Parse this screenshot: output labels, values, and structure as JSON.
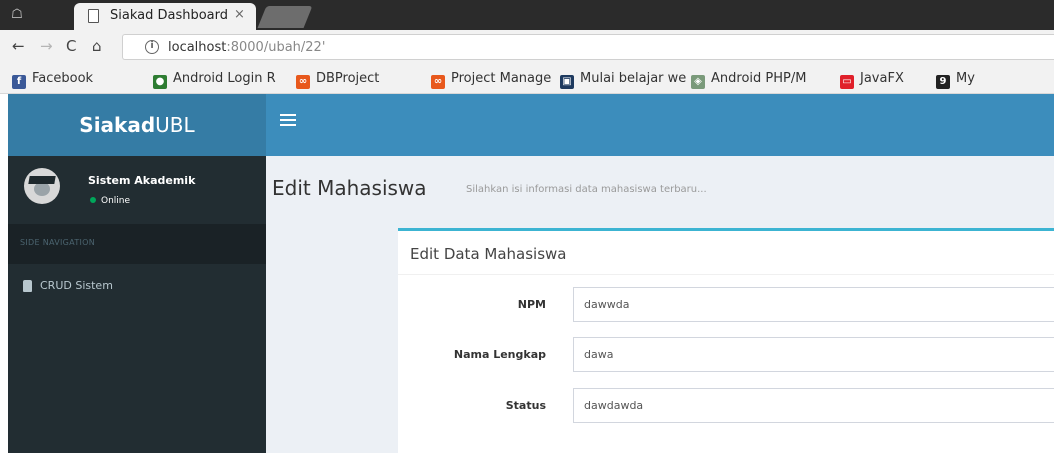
{
  "browser": {
    "tab_title": "Siakad Dashboard",
    "tab_close": "×",
    "url_host": "localhost",
    "url_rest": ":8000/ubah/22'",
    "bookmarks": [
      {
        "label": "Facebook",
        "icon": "facebook-icon",
        "color": "#3b5998",
        "glyph": "f",
        "faded": false
      },
      {
        "label": "Android Login R",
        "icon": "android-icon",
        "color": "#2e7d32",
        "glyph": "●",
        "faded": false
      },
      {
        "label": "DBProject",
        "icon": "project-icon",
        "color": "#e8581c",
        "glyph": "∞",
        "faded": false
      },
      {
        "label": "Project Manage",
        "icon": "project-icon",
        "color": "#e8581c",
        "glyph": "∞",
        "faded": false
      },
      {
        "label": "Mulai belajar we",
        "icon": "learn-icon",
        "color": "#1e3a5f",
        "glyph": "▣",
        "faded": false
      },
      {
        "label": "Android PHP/M",
        "icon": "android-php-icon",
        "color": "#7a9a7a",
        "glyph": "◈",
        "faded": false
      },
      {
        "label": "JavaFX",
        "icon": "javafx-icon",
        "color": "#e0202a",
        "glyph": "▭",
        "faded": false
      },
      {
        "label": "My",
        "icon": "my-icon",
        "color": "#222222",
        "glyph": "9",
        "faded": false
      }
    ]
  },
  "app": {
    "logo_bold": "Siakad",
    "logo_light": "UBL"
  },
  "sidebar": {
    "user_name": "Sistem Akademik",
    "user_status": "Online",
    "header": "SIDE NAVIGATION",
    "items": [
      {
        "label": "CRUD Sistem",
        "icon": "database-icon"
      }
    ]
  },
  "content": {
    "title": "Edit Mahasiswa",
    "subtitle": "Silahkan isi informasi data mahasiswa terbaru...",
    "box_title": "Edit Data Mahasiswa",
    "fields": [
      {
        "label": "NPM",
        "value": "dawwda"
      },
      {
        "label": "Nama Lengkap",
        "value": "dawa"
      },
      {
        "label": "Status",
        "value": "dawdawda"
      }
    ]
  },
  "colors": {
    "navbar": "#3c8dbc",
    "logo_bar": "#357ca5",
    "sidebar": "#222d32",
    "box_accent": "#3cb4d2"
  }
}
